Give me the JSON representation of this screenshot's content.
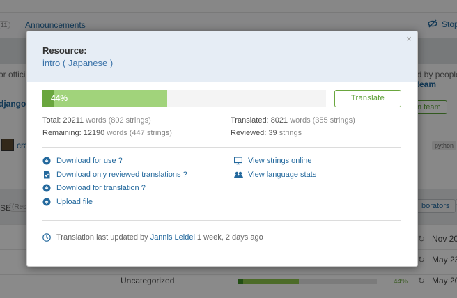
{
  "background": {
    "tab_count": "11",
    "tab_label": "Announcements",
    "stop_label": "Stop",
    "official_text": "or officia",
    "team_text_left": "djangop",
    "ed_by_people_text": "ed by people",
    "team_link": "team",
    "team_button": "n team",
    "user_text": "cra",
    "python_tag": "python",
    "se_label": "SE",
    "res_label": "(Reso",
    "collab_button": "borators",
    "rows": [
      {
        "category": "",
        "pct": "",
        "date": "Nov 20"
      },
      {
        "category": "",
        "pct": "",
        "date": "May 23,"
      },
      {
        "category": "Uncategorized",
        "pct": "44%",
        "date": "May 20,"
      }
    ],
    "row_progress": 0.44
  },
  "modal": {
    "close_symbol": "×",
    "resource_label": "Resource:",
    "resource_name": "intro",
    "open_paren": "(",
    "language": "Japanese",
    "close_paren": ")",
    "progress_pct": "44%",
    "progress_value": 0.44,
    "translate_button": "Translate",
    "stats": {
      "total_label": "Total:",
      "total_words": "20211",
      "total_words_unit": "words",
      "total_strings": "(802 strings)",
      "remaining_label": "Remaining:",
      "remaining_words": "12190",
      "remaining_words_unit": "words",
      "remaining_strings": "(447 strings)",
      "translated_label": "Translated:",
      "translated_words": "8021",
      "translated_words_unit": "words",
      "translated_strings": "(355 strings)",
      "reviewed_label": "Reviewed:",
      "reviewed_strings": "39",
      "reviewed_strings_unit": "strings"
    },
    "actions": {
      "download_use": "Download for use",
      "download_reviewed": "Download only reviewed translations",
      "download_translation": "Download for translation",
      "upload_file": "Upload file",
      "view_online": "View strings online",
      "view_stats": "View language stats",
      "help_mark": "?"
    },
    "footer": {
      "prefix": "Translation last updated by",
      "user": "Jannis Leidel",
      "time": "1 week, 2 days ago"
    }
  },
  "colors": {
    "accent_green": "#6aa63e",
    "light_green": "#a1d37b",
    "link_blue": "#24699d",
    "header_bg": "#e6edf5"
  }
}
